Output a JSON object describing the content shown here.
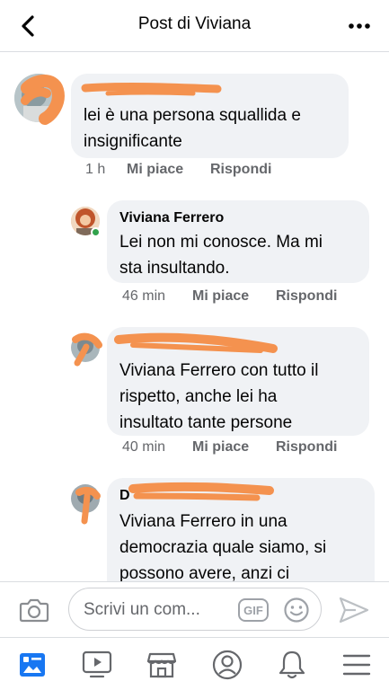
{
  "header": {
    "title": "Post di Viviana",
    "back_icon": "chevron-left-icon",
    "more_icon": "more-dots-icon"
  },
  "comments": [
    {
      "author": "",
      "text_lines": [
        "lei è una persona squallida e",
        "insignificante"
      ],
      "time": "1 h",
      "like": "Mi piace",
      "reply": "Rispondi"
    },
    {
      "author": "Viviana Ferrero",
      "text_lines": [
        "Lei non mi conosce. Ma mi",
        "sta insultando."
      ],
      "time": "46 min",
      "like": "Mi piace",
      "reply": "Rispondi"
    },
    {
      "author": "",
      "text_lines": [
        "Viviana Ferrero con tutto il",
        "rispetto, anche lei ha",
        "insultato tante persone"
      ],
      "time": "40 min",
      "like": "Mi piace",
      "reply": "Rispondi"
    },
    {
      "author": "D",
      "text_lines": [
        "Viviana Ferrero in una",
        "democrazia quale siamo, si",
        "possono avere, anzi ci"
      ],
      "time": "",
      "like": "",
      "reply": ""
    }
  ],
  "composer": {
    "placeholder": "Scrivi un com...",
    "gif_label": "GIF"
  },
  "tabbar": {
    "items": [
      "news-feed-icon",
      "video-icon",
      "marketplace-icon",
      "profile-icon",
      "notifications-icon",
      "menu-icon"
    ]
  },
  "colors": {
    "accent": "#1877f2",
    "bubble": "#f0f2f5",
    "meta": "#65676b",
    "scribble": "#f4924f",
    "online": "#31a24c"
  }
}
